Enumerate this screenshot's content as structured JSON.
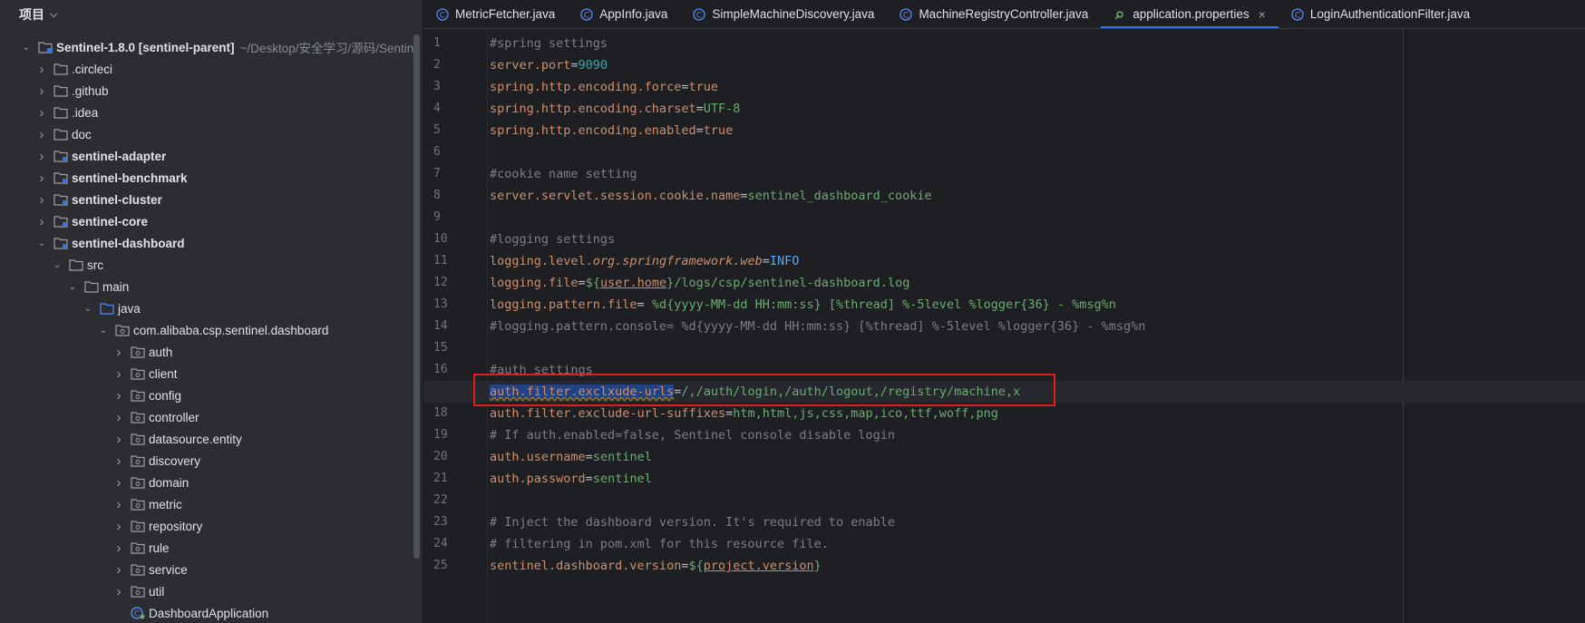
{
  "project_panel": {
    "title": "项目",
    "root": {
      "label": "Sentinel-1.8.0 [sentinel-parent]",
      "hint": "~/Desktop/安全学习/源码/Sentin"
    },
    "items": [
      {
        "label": ".circleci",
        "level": 1,
        "expanded": false,
        "bold": false,
        "icon": "folder-icon"
      },
      {
        "label": ".github",
        "level": 1,
        "expanded": false,
        "bold": false,
        "icon": "folder-icon"
      },
      {
        "label": ".idea",
        "level": 1,
        "expanded": false,
        "bold": false,
        "icon": "folder-icon"
      },
      {
        "label": "doc",
        "level": 1,
        "expanded": false,
        "bold": false,
        "icon": "folder-icon"
      },
      {
        "label": "sentinel-adapter",
        "level": 1,
        "expanded": false,
        "bold": true,
        "icon": "module-folder-icon"
      },
      {
        "label": "sentinel-benchmark",
        "level": 1,
        "expanded": false,
        "bold": true,
        "icon": "module-folder-icon"
      },
      {
        "label": "sentinel-cluster",
        "level": 1,
        "expanded": false,
        "bold": true,
        "icon": "module-folder-icon"
      },
      {
        "label": "sentinel-core",
        "level": 1,
        "expanded": false,
        "bold": true,
        "icon": "module-folder-icon"
      },
      {
        "label": "sentinel-dashboard",
        "level": 1,
        "expanded": true,
        "bold": true,
        "icon": "module-folder-icon"
      },
      {
        "label": "src",
        "level": 2,
        "expanded": true,
        "bold": false,
        "icon": "folder-icon"
      },
      {
        "label": "main",
        "level": 3,
        "expanded": true,
        "bold": false,
        "icon": "folder-icon"
      },
      {
        "label": "java",
        "level": 4,
        "expanded": true,
        "bold": false,
        "icon": "source-folder-icon"
      },
      {
        "label": "com.alibaba.csp.sentinel.dashboard",
        "level": 5,
        "expanded": true,
        "bold": false,
        "icon": "package-icon"
      },
      {
        "label": "auth",
        "level": 6,
        "expanded": false,
        "bold": false,
        "icon": "package-icon"
      },
      {
        "label": "client",
        "level": 6,
        "expanded": false,
        "bold": false,
        "icon": "package-icon"
      },
      {
        "label": "config",
        "level": 6,
        "expanded": false,
        "bold": false,
        "icon": "package-icon"
      },
      {
        "label": "controller",
        "level": 6,
        "expanded": false,
        "bold": false,
        "icon": "package-icon"
      },
      {
        "label": "datasource.entity",
        "level": 6,
        "expanded": false,
        "bold": false,
        "icon": "package-icon"
      },
      {
        "label": "discovery",
        "level": 6,
        "expanded": false,
        "bold": false,
        "icon": "package-icon"
      },
      {
        "label": "domain",
        "level": 6,
        "expanded": false,
        "bold": false,
        "icon": "package-icon"
      },
      {
        "label": "metric",
        "level": 6,
        "expanded": false,
        "bold": false,
        "icon": "package-icon"
      },
      {
        "label": "repository",
        "level": 6,
        "expanded": false,
        "bold": false,
        "icon": "package-icon"
      },
      {
        "label": "rule",
        "level": 6,
        "expanded": false,
        "bold": false,
        "icon": "package-icon"
      },
      {
        "label": "service",
        "level": 6,
        "expanded": false,
        "bold": false,
        "icon": "package-icon"
      },
      {
        "label": "util",
        "level": 6,
        "expanded": false,
        "bold": false,
        "icon": "package-icon"
      },
      {
        "label": "DashboardApplication",
        "level": 6,
        "expanded": null,
        "bold": false,
        "icon": "spring-class-icon"
      }
    ]
  },
  "tabs": [
    {
      "label": "MetricFetcher.java",
      "icon": "class-icon",
      "active": false
    },
    {
      "label": "AppInfo.java",
      "icon": "class-icon",
      "active": false
    },
    {
      "label": "SimpleMachineDiscovery.java",
      "icon": "class-icon",
      "active": false
    },
    {
      "label": "MachineRegistryController.java",
      "icon": "class-icon",
      "active": false
    },
    {
      "label": "application.properties",
      "icon": "properties-icon",
      "active": true,
      "close": "×"
    },
    {
      "label": "LoginAuthenticationFilter.java",
      "icon": "class-icon",
      "active": false
    }
  ],
  "editor": {
    "current_line": 17,
    "lines": [
      [
        {
          "t": "#spring settings",
          "c": "comment"
        }
      ],
      [
        {
          "t": "server.port",
          "c": "key"
        },
        {
          "t": "=",
          "c": "eq"
        },
        {
          "t": "9090",
          "c": "num"
        }
      ],
      [
        {
          "t": "spring.http.encoding.force",
          "c": "key"
        },
        {
          "t": "=",
          "c": "eq"
        },
        {
          "t": "true",
          "c": "key"
        }
      ],
      [
        {
          "t": "spring.http.encoding.charset",
          "c": "key"
        },
        {
          "t": "=",
          "c": "eq"
        },
        {
          "t": "UTF-8",
          "c": "val"
        }
      ],
      [
        {
          "t": "spring.http.encoding.enabled",
          "c": "key"
        },
        {
          "t": "=",
          "c": "eq"
        },
        {
          "t": "true",
          "c": "key"
        }
      ],
      [],
      [
        {
          "t": "#cookie name setting",
          "c": "comment"
        }
      ],
      [
        {
          "t": "server.servlet.session.cookie.name",
          "c": "key"
        },
        {
          "t": "=",
          "c": "eq"
        },
        {
          "t": "sentinel_dashboard_cookie",
          "c": "val"
        }
      ],
      [],
      [
        {
          "t": "#logging settings",
          "c": "comment"
        }
      ],
      [
        {
          "t": "logging.level.",
          "c": "key"
        },
        {
          "t": "org.springframework.web",
          "c": "key italic"
        },
        {
          "t": "=",
          "c": "eq"
        },
        {
          "t": "INFO",
          "c": "const"
        }
      ],
      [
        {
          "t": "logging.file",
          "c": "key"
        },
        {
          "t": "=",
          "c": "eq"
        },
        {
          "t": "${",
          "c": "val"
        },
        {
          "t": "user.home",
          "c": "key var"
        },
        {
          "t": "}/logs/csp/sentinel-dashboard.log",
          "c": "val"
        }
      ],
      [
        {
          "t": "logging.pattern.file",
          "c": "key"
        },
        {
          "t": "=",
          "c": "eq"
        },
        {
          "t": " %d{yyyy-MM-dd HH:mm:ss} [%thread] %-5level %logger{36} - %msg%n",
          "c": "val"
        }
      ],
      [
        {
          "t": "#logging.pattern.console= %d{yyyy-MM-dd HH:mm:ss} [%thread] %-5level %logger{36} - %msg%n",
          "c": "comment"
        }
      ],
      [],
      [
        {
          "t": "#auth settings",
          "c": "comment"
        }
      ],
      [
        {
          "t": "auth.filter.exclxude-urls",
          "c": "key sel"
        },
        {
          "t": "=",
          "c": "eq"
        },
        {
          "t": "/,/auth/login,/auth/logout,/registry/machine,x",
          "c": "val"
        }
      ],
      [
        {
          "t": "auth.filter.exclude-url-suffixes",
          "c": "key"
        },
        {
          "t": "=",
          "c": "eq"
        },
        {
          "t": "htm,html,js,css,map,ico,ttf,woff,png",
          "c": "val"
        }
      ],
      [
        {
          "t": "# If auth.enabled=false, Sentinel console disable login",
          "c": "comment"
        }
      ],
      [
        {
          "t": "auth.username",
          "c": "key"
        },
        {
          "t": "=",
          "c": "eq"
        },
        {
          "t": "sentinel",
          "c": "val"
        }
      ],
      [
        {
          "t": "auth.password",
          "c": "key"
        },
        {
          "t": "=",
          "c": "eq"
        },
        {
          "t": "sentinel",
          "c": "val"
        }
      ],
      [],
      [
        {
          "t": "# Inject the dashboard version. It's required to enable",
          "c": "comment"
        }
      ],
      [
        {
          "t": "# filtering in pom.xml for this resource file.",
          "c": "comment"
        }
      ],
      [
        {
          "t": "sentinel.dashboard.version",
          "c": "key"
        },
        {
          "t": "=",
          "c": "eq"
        },
        {
          "t": "${",
          "c": "val"
        },
        {
          "t": "project.version",
          "c": "key var"
        },
        {
          "t": "}",
          "c": "val"
        }
      ]
    ]
  },
  "colors": {
    "accent": "#3574f0",
    "highlight_box": "#e0201d",
    "folder": "#9da0a8",
    "source_folder": "#548af7"
  }
}
